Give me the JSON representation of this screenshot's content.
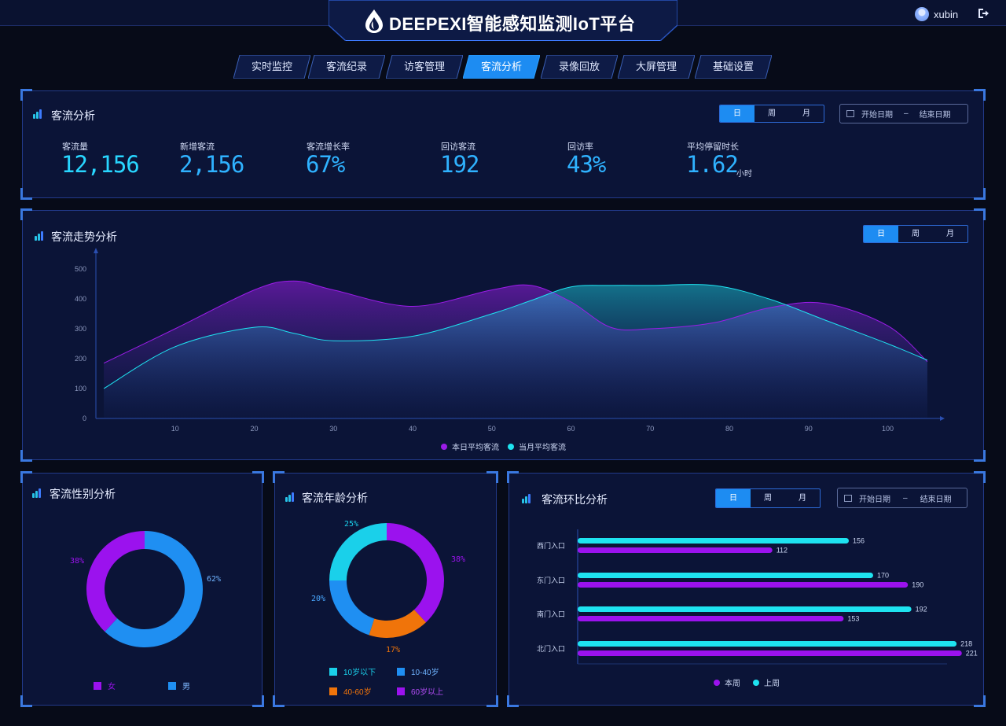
{
  "header": {
    "title": "DEEPEXI智能感知监测IoT平台",
    "user": "xubin"
  },
  "nav": {
    "tabs": [
      {
        "label": "实时监控",
        "active": false
      },
      {
        "label": "客流纪录",
        "active": false
      },
      {
        "label": "访客管理",
        "active": false
      },
      {
        "label": "客流分析",
        "active": true
      },
      {
        "label": "录像回放",
        "active": false
      },
      {
        "label": "大屏管理",
        "active": false
      },
      {
        "label": "基础设置",
        "active": false
      }
    ]
  },
  "period": {
    "day": "日",
    "week": "周",
    "month": "月"
  },
  "date_range": {
    "start": "开始日期",
    "sep": "–",
    "end": "结束日期"
  },
  "summary": {
    "title": "客流分析",
    "kpis": [
      {
        "label": "客流量",
        "value": "12,156",
        "color": "#28d6ff"
      },
      {
        "label": "新增客流",
        "value": "2,156",
        "color": "#2fb2ff"
      },
      {
        "label": "客流增长率",
        "value": "67%",
        "color": "#2fb2ff"
      },
      {
        "label": "回访客流",
        "value": "192",
        "color": "#2fb2ff"
      },
      {
        "label": "回访率",
        "value": "43%",
        "color": "#2fb2ff"
      },
      {
        "label": "平均停留时长",
        "value": "1.62",
        "unit": "小时",
        "color": "#2fb2ff"
      }
    ]
  },
  "trend": {
    "title": "客流走势分析",
    "chart_data": {
      "type": "area",
      "x": [
        1,
        10,
        20,
        25,
        30,
        40,
        50,
        55,
        60,
        65,
        70,
        78,
        85,
        92,
        100,
        105
      ],
      "xticks": [
        10,
        20,
        30,
        40,
        50,
        60,
        70,
        80,
        90,
        100
      ],
      "yticks": [
        0,
        100,
        200,
        300,
        400,
        500
      ],
      "ylim": [
        0,
        500
      ],
      "xlim": [
        0,
        106
      ],
      "series": [
        {
          "name": "本日平均客流",
          "color": "#9b1ce8",
          "values": [
            185,
            300,
            430,
            460,
            430,
            375,
            430,
            445,
            390,
            305,
            300,
            320,
            370,
            385,
            310,
            190
          ]
        },
        {
          "name": "当月平均客流",
          "color": "#1ee3f0",
          "values": [
            100,
            240,
            305,
            285,
            260,
            275,
            350,
            395,
            440,
            445,
            445,
            445,
            400,
            330,
            250,
            195
          ]
        }
      ]
    }
  },
  "gender": {
    "title": "客流性别分析",
    "chart_data": {
      "type": "pie",
      "slices": [
        {
          "label": "女",
          "value": 38,
          "text": "38%",
          "color": "#9b12ee"
        },
        {
          "label": "男",
          "value": 62,
          "text": "62%",
          "color": "#1f8ff2"
        }
      ]
    }
  },
  "age": {
    "title": "客流年龄分析",
    "chart_data": {
      "type": "pie",
      "slices": [
        {
          "label": "10岁以下",
          "value": 25,
          "text": "25%",
          "color": "#1ad0ea"
        },
        {
          "label": "10-40岁",
          "value": 20,
          "text": "20%",
          "color": "#1f8ff2"
        },
        {
          "label": "40-60岁",
          "value": 17,
          "text": "17%",
          "color": "#f0740a"
        },
        {
          "label": "60岁以上",
          "value": 38,
          "text": "38%",
          "color": "#9b12ee"
        }
      ]
    }
  },
  "compare": {
    "title": "客流环比分析",
    "chart_data": {
      "type": "bar",
      "categories": [
        "西门入口",
        "东门入口",
        "南门入口",
        "北门入口"
      ],
      "xlim": [
        0,
        230
      ],
      "series": [
        {
          "name": "上周",
          "color": "#1ee3f0",
          "values": [
            156,
            170,
            192,
            218
          ]
        },
        {
          "name": "本周",
          "color": "#9b12ee",
          "values": [
            112,
            190,
            153,
            221
          ]
        }
      ]
    }
  }
}
